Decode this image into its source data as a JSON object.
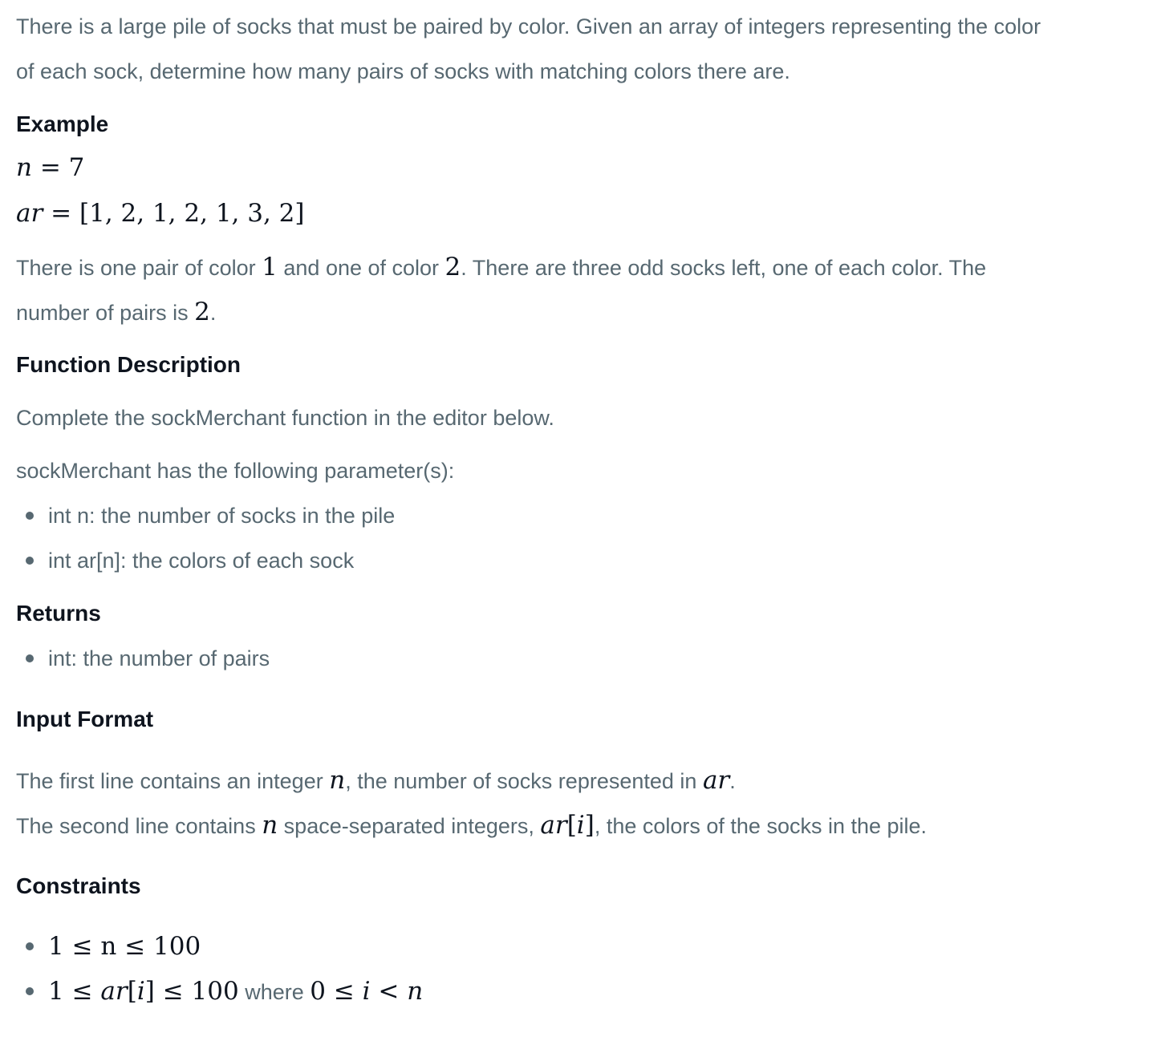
{
  "intro": {
    "line1": "There is a large pile of socks that must be paired by color. Given an array of integers representing the color",
    "line2": "of each sock, determine how many pairs of socks with matching colors there are."
  },
  "example": {
    "heading": "Example",
    "n_lhs": "n",
    "n_eq": " = ",
    "n_val": "7",
    "ar_lhs": "ar",
    "ar_eq": " = ",
    "ar_val": "[1, 2, 1, 2, 1, 3, 2]",
    "explain_a": "There is one pair of color ",
    "explain_m1": "1",
    "explain_b": " and one of color ",
    "explain_m2": "2",
    "explain_c": ". There are three odd socks left, one of each color. The",
    "explain2_a": "number of pairs is ",
    "explain2_m": "2",
    "explain2_b": "."
  },
  "function_description": {
    "heading": "Function Description",
    "complete": "Complete the sockMerchant function in the editor below.",
    "params_intro": "sockMerchant has the following parameter(s):",
    "params": [
      "int n: the number of socks in the pile",
      "int ar[n]: the colors of each sock"
    ]
  },
  "returns": {
    "heading": "Returns",
    "items": [
      "int: the number of pairs"
    ]
  },
  "input_format": {
    "heading": "Input Format",
    "l1_a": "The first line contains an integer ",
    "l1_m1": "n",
    "l1_b": ", the number of socks represented in ",
    "l1_m2": "ar",
    "l1_c": ".",
    "l2_a": "The second line contains ",
    "l2_m1": "n",
    "l2_b": " space-separated integers, ",
    "l2_m2a": "ar",
    "l2_m2b": "[",
    "l2_m2c": "i",
    "l2_m2d": "]",
    "l2_c": ", the colors of the socks in the pile."
  },
  "constraints": {
    "heading": "Constraints",
    "c1": "1 ≤ n ≤ 100",
    "c2_math_a": "1 ≤ ",
    "c2_math_b": "ar",
    "c2_math_c": "[",
    "c2_math_d": "i",
    "c2_math_e": "] ≤ 100",
    "c2_where": " where ",
    "c2_math2_a": "0 ≤ ",
    "c2_math2_b": "i",
    "c2_math2_c": " < ",
    "c2_math2_d": "n"
  }
}
